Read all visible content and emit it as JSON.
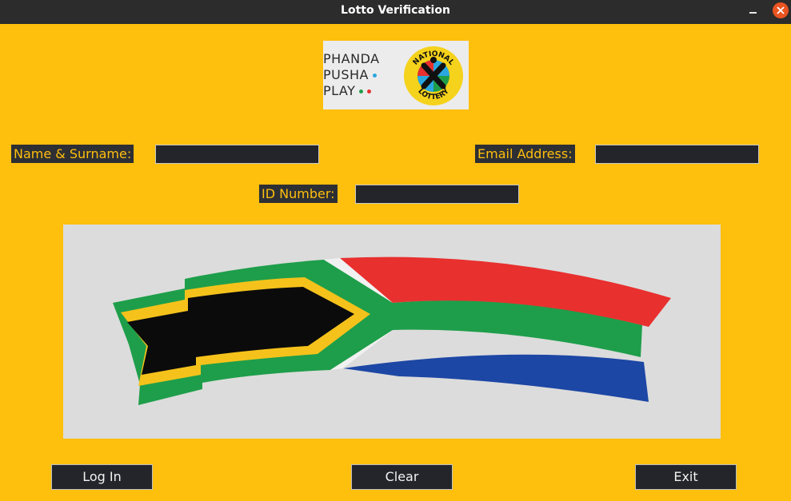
{
  "window": {
    "title": "Lotto Verification"
  },
  "logo": {
    "lines": [
      "PHANDA",
      "PUSHA",
      "PLAY"
    ],
    "seal_top": "NATIONAL",
    "seal_bottom": "LOTTERY"
  },
  "form": {
    "name_label": "Name & Surname:",
    "email_label": "Email Address:",
    "id_label": "ID Number:",
    "name_value": "",
    "email_value": "",
    "id_value": ""
  },
  "buttons": {
    "login": "Log In",
    "clear": "Clear",
    "exit": "Exit"
  },
  "colors": {
    "background": "#ffbf0d",
    "field_bg": "#23252a",
    "label_bg": "#2d2f33",
    "label_text": "#ffbf0d",
    "close_button": "#e95420",
    "flag_red": "#e8302f",
    "flag_green": "#1e9e4a",
    "flag_blue": "#1d47a5",
    "flag_black": "#0b0b0b",
    "flag_gold": "#f5c21b"
  },
  "icons": {
    "minimize": "minimize-icon",
    "close": "close-icon",
    "flag": "south-african-flag-image"
  }
}
